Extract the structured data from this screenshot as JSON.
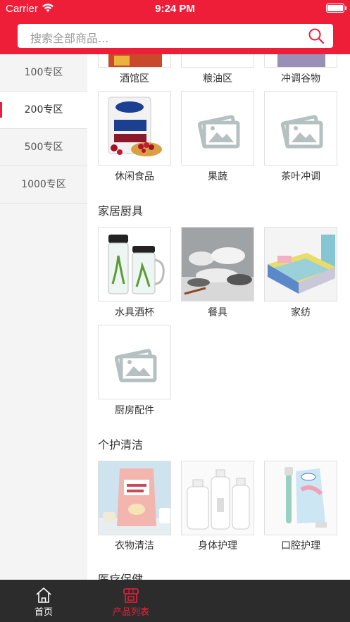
{
  "status_bar": {
    "carrier": "Carrier",
    "time": "9:24 PM"
  },
  "search": {
    "placeholder": "搜索全部商品..."
  },
  "sidebar": {
    "items": [
      {
        "label": "100专区",
        "active": false
      },
      {
        "label": "200专区",
        "active": true
      },
      {
        "label": "500专区",
        "active": false
      },
      {
        "label": "1000专区",
        "active": false
      }
    ]
  },
  "content": {
    "top_row": [
      "酒馆区",
      "粮油区",
      "冲调谷物"
    ],
    "row2": [
      "休闲食品",
      "果蔬",
      "茶叶冲调"
    ],
    "sections": [
      {
        "title": "家居厨具",
        "items": [
          "水具酒杯",
          "餐具",
          "家纺",
          "厨房配件"
        ]
      },
      {
        "title": "个护清洁",
        "items": [
          "衣物清洁",
          "身体护理",
          "口腔护理"
        ]
      },
      {
        "title": "医疗保健"
      }
    ]
  },
  "tabbar": {
    "items": [
      {
        "label": "首页"
      },
      {
        "label": "产品列表"
      }
    ]
  },
  "colors": {
    "accent": "#ee1e39",
    "tabbar_bg": "#2c2c2c"
  }
}
